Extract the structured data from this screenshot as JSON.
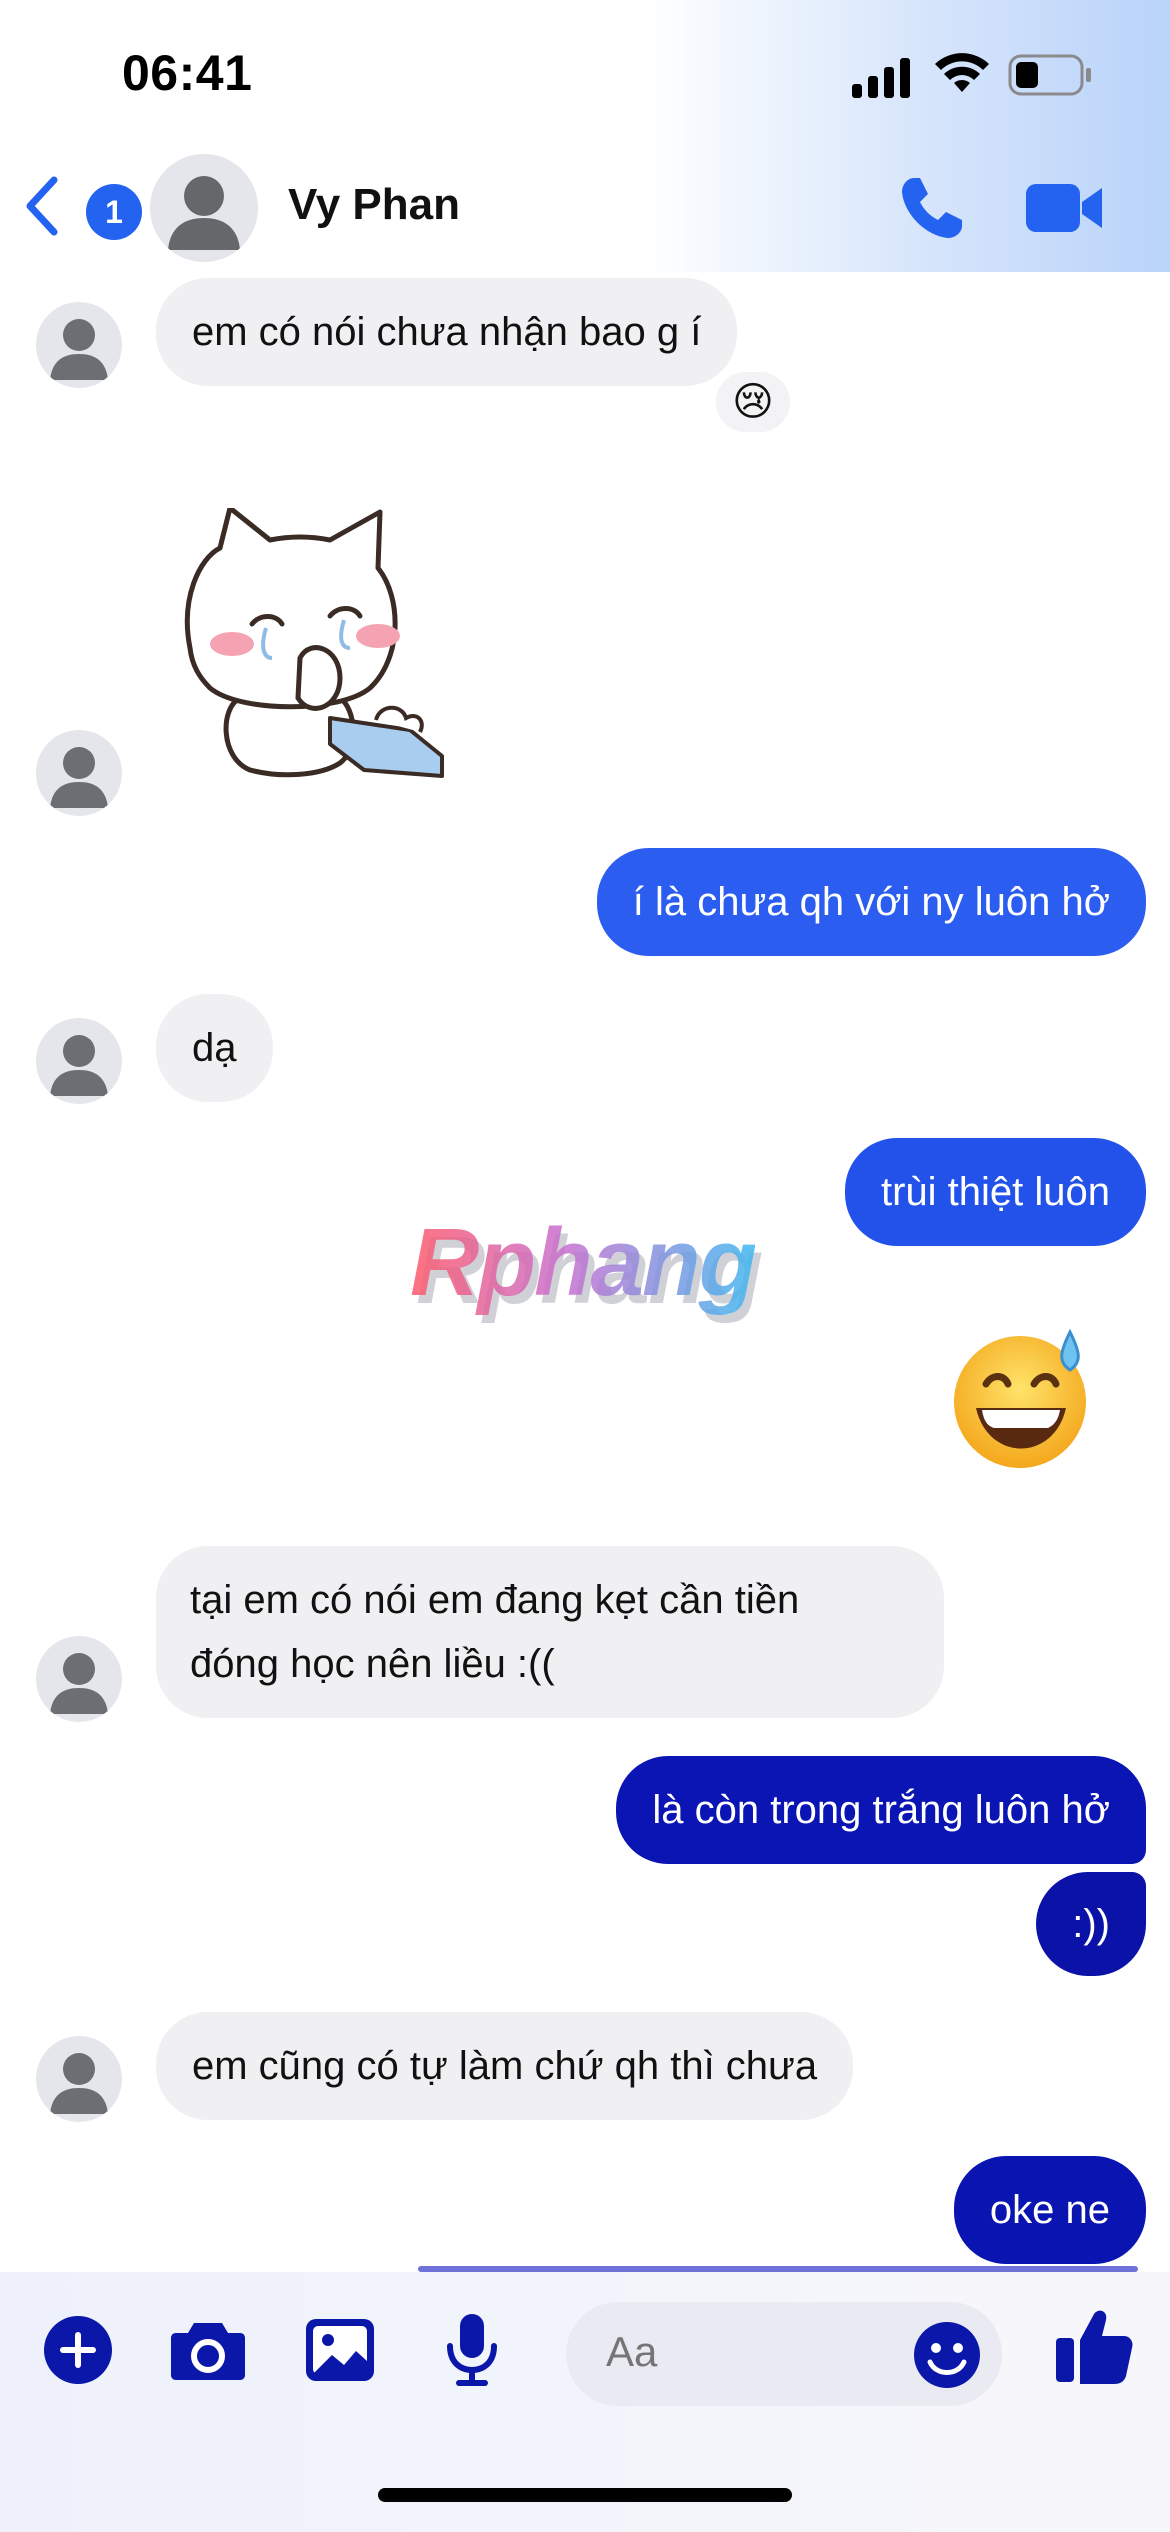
{
  "status_bar": {
    "time": "06:41"
  },
  "header": {
    "back_badge": "1",
    "contact_name": "Vy Phan"
  },
  "messages": [
    {
      "side": "in",
      "text": "em có nói chưa nhận bao g í",
      "reaction": "😢"
    },
    {
      "side": "in",
      "type": "sticker"
    },
    {
      "side": "out",
      "text": "í là chưa qh với ny luôn hở"
    },
    {
      "side": "in",
      "text": "dạ"
    },
    {
      "side": "out",
      "text": "trùi thiệt luôn"
    },
    {
      "side": "out",
      "type": "emoji",
      "emoji": "😅"
    },
    {
      "side": "in",
      "text_lines": [
        "tại em có nói em đang kẹt cần tiền",
        "đóng học nên liều :(("
      ]
    },
    {
      "side": "out",
      "text": "là còn trong trắng luôn hở"
    },
    {
      "side": "out",
      "text": ":))"
    },
    {
      "side": "in",
      "text": "em cũng có tự làm chứ qh thì chưa"
    },
    {
      "side": "out",
      "text": "oke ne"
    }
  ],
  "watermark": "Rphang",
  "composer": {
    "placeholder": "Aa"
  },
  "colors": {
    "accent": "#2463f0",
    "outgoing_light": "#2b5df0",
    "outgoing_dark": "#0a15b4",
    "incoming": "#f0f0f3",
    "composer_icon": "#0a17a8"
  }
}
